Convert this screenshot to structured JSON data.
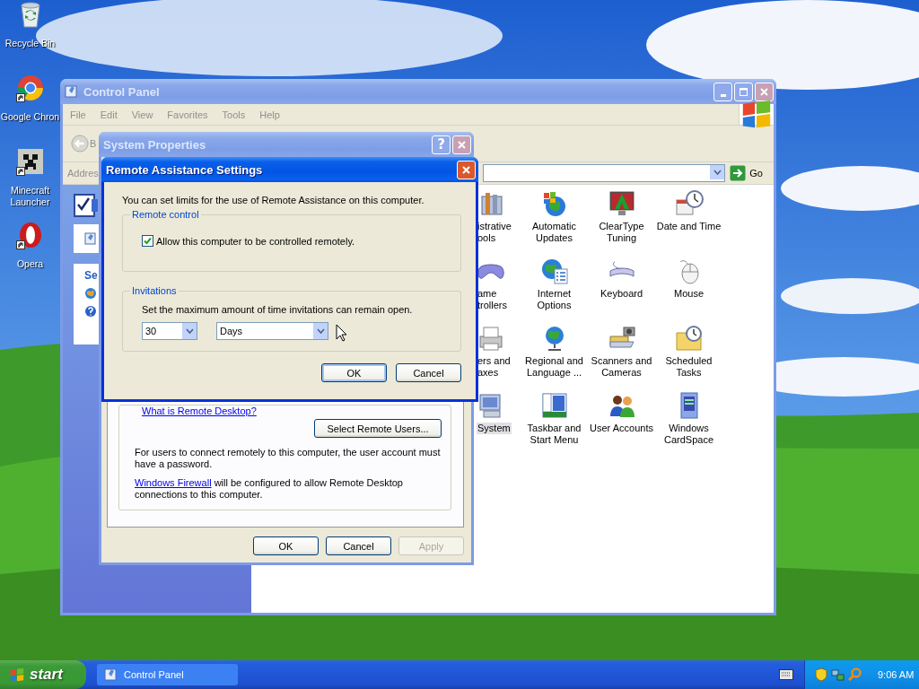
{
  "desktop": {
    "icons": [
      {
        "kind": "recycle",
        "label": "Recycle Bin"
      },
      {
        "kind": "chrome",
        "label": "Google Chron"
      },
      {
        "kind": "block",
        "label": "Minecraft Launcher"
      },
      {
        "kind": "opera",
        "label": "Opera"
      }
    ]
  },
  "control_panel": {
    "title": "Control Panel",
    "active": false,
    "menu": [
      "File",
      "Edit",
      "View",
      "Favorites",
      "Tools",
      "Help"
    ],
    "back_label": "B",
    "address_label": "Addres",
    "go_label": "Go",
    "task_heading": "Se",
    "items": [
      {
        "kind": "admin",
        "lines": [
          "istrative",
          "ools"
        ],
        "selected": false
      },
      {
        "kind": "updates",
        "lines": [
          "Automatic",
          "Updates"
        ],
        "selected": false
      },
      {
        "kind": "cleartype",
        "lines": [
          "ClearType",
          "Tuning"
        ],
        "selected": false
      },
      {
        "kind": "datetime",
        "lines": [
          "Date and Time"
        ],
        "selected": false
      },
      {
        "kind": "gamepad",
        "lines": [
          "ame",
          "trollers"
        ],
        "selected": false
      },
      {
        "kind": "internet",
        "lines": [
          "Internet",
          "Options"
        ],
        "selected": false
      },
      {
        "kind": "keyboard",
        "lines": [
          "Keyboard"
        ],
        "selected": false
      },
      {
        "kind": "mouse",
        "lines": [
          "Mouse"
        ],
        "selected": false
      },
      {
        "kind": "printer",
        "lines": [
          "ers and",
          "axes"
        ],
        "selected": false
      },
      {
        "kind": "regional",
        "lines": [
          "Regional and",
          "Language ..."
        ],
        "selected": false
      },
      {
        "kind": "scanner",
        "lines": [
          "Scanners and",
          "Cameras"
        ],
        "selected": false
      },
      {
        "kind": "scheduled",
        "lines": [
          "Scheduled",
          "Tasks"
        ],
        "selected": false
      },
      {
        "kind": "system",
        "lines": [
          "System"
        ],
        "selected": true
      },
      {
        "kind": "taskbar",
        "lines": [
          "Taskbar and",
          "Start Menu"
        ],
        "selected": false
      },
      {
        "kind": "users",
        "lines": [
          "User Accounts"
        ],
        "selected": false
      },
      {
        "kind": "cardspace",
        "lines": [
          "Windows",
          "CardSpace"
        ],
        "selected": false
      }
    ]
  },
  "system_properties": {
    "title": "System Properties",
    "active": false,
    "help_button": "?",
    "link": "What is Remote Desktop?",
    "select_users": "Select Remote Users...",
    "note": "For users to connect remotely to this computer, the user account must have a password.",
    "firewall_link": "Windows Firewall",
    "firewall_text": "will be configured to allow Remote Desktop connections to this computer.",
    "buttons": [
      {
        "label": "OK",
        "disabled": false
      },
      {
        "label": "Cancel",
        "disabled": false
      },
      {
        "label": "Apply",
        "disabled": true
      }
    ]
  },
  "remote_assistance": {
    "title": "Remote Assistance Settings",
    "active": true,
    "intro": "You can set limits for the use of Remote Assistance on this computer.",
    "remote_control": {
      "legend": "Remote control",
      "checkbox": {
        "label": "Allow this computer to be controlled remotely.",
        "checked": true
      }
    },
    "invitations": {
      "legend": "Invitations",
      "text": "Set the maximum amount of time invitations can remain open.",
      "amount": "30",
      "unit": "Days"
    },
    "buttons": [
      {
        "label": "OK",
        "default": true
      },
      {
        "label": "Cancel",
        "default": false
      }
    ]
  },
  "taskbar": {
    "start": "start",
    "tasks": [
      {
        "label": "Control Panel",
        "selected": false
      }
    ],
    "clock": "9:06 AM"
  }
}
